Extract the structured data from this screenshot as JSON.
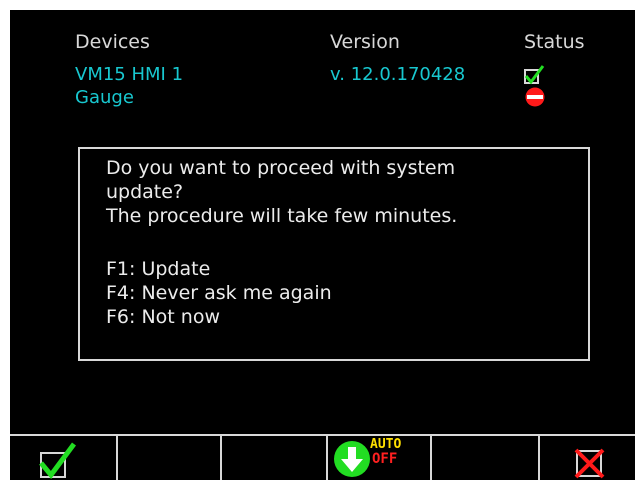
{
  "devices_table": {
    "headers": {
      "devices": "Devices",
      "version": "Version",
      "status": "Status"
    },
    "rows": [
      {
        "device": "VM15 HMI 1",
        "version": "v. 12.0.170428",
        "status_icon": "check-icon"
      },
      {
        "device": "Gauge",
        "version": "",
        "status_icon": "no-entry-icon"
      }
    ]
  },
  "dialog": {
    "lines": [
      "Do you want to proceed with system",
      "update?",
      "The procedure will take few minutes.",
      "",
      "F1: Update",
      "F4: Never ask me again",
      "F6: Not now"
    ]
  },
  "function_bar": {
    "keys": [
      {
        "key": "F1",
        "icon": "check-icon"
      },
      {
        "key": "F2",
        "icon": ""
      },
      {
        "key": "F3",
        "icon": ""
      },
      {
        "key": "F4",
        "icon": "download-icon",
        "label_top": "AUTO",
        "label_bottom": "OFF"
      },
      {
        "key": "F5",
        "icon": ""
      },
      {
        "key": "F6",
        "icon": "cancel-icon"
      }
    ]
  },
  "colors": {
    "background": "#000000",
    "text": "#d8d8d8",
    "accent": "#18c8d0",
    "ok": "#22dd22",
    "error": "#ff1a1a",
    "auto_label": "#ffe000",
    "off_label": "#ff2020"
  }
}
